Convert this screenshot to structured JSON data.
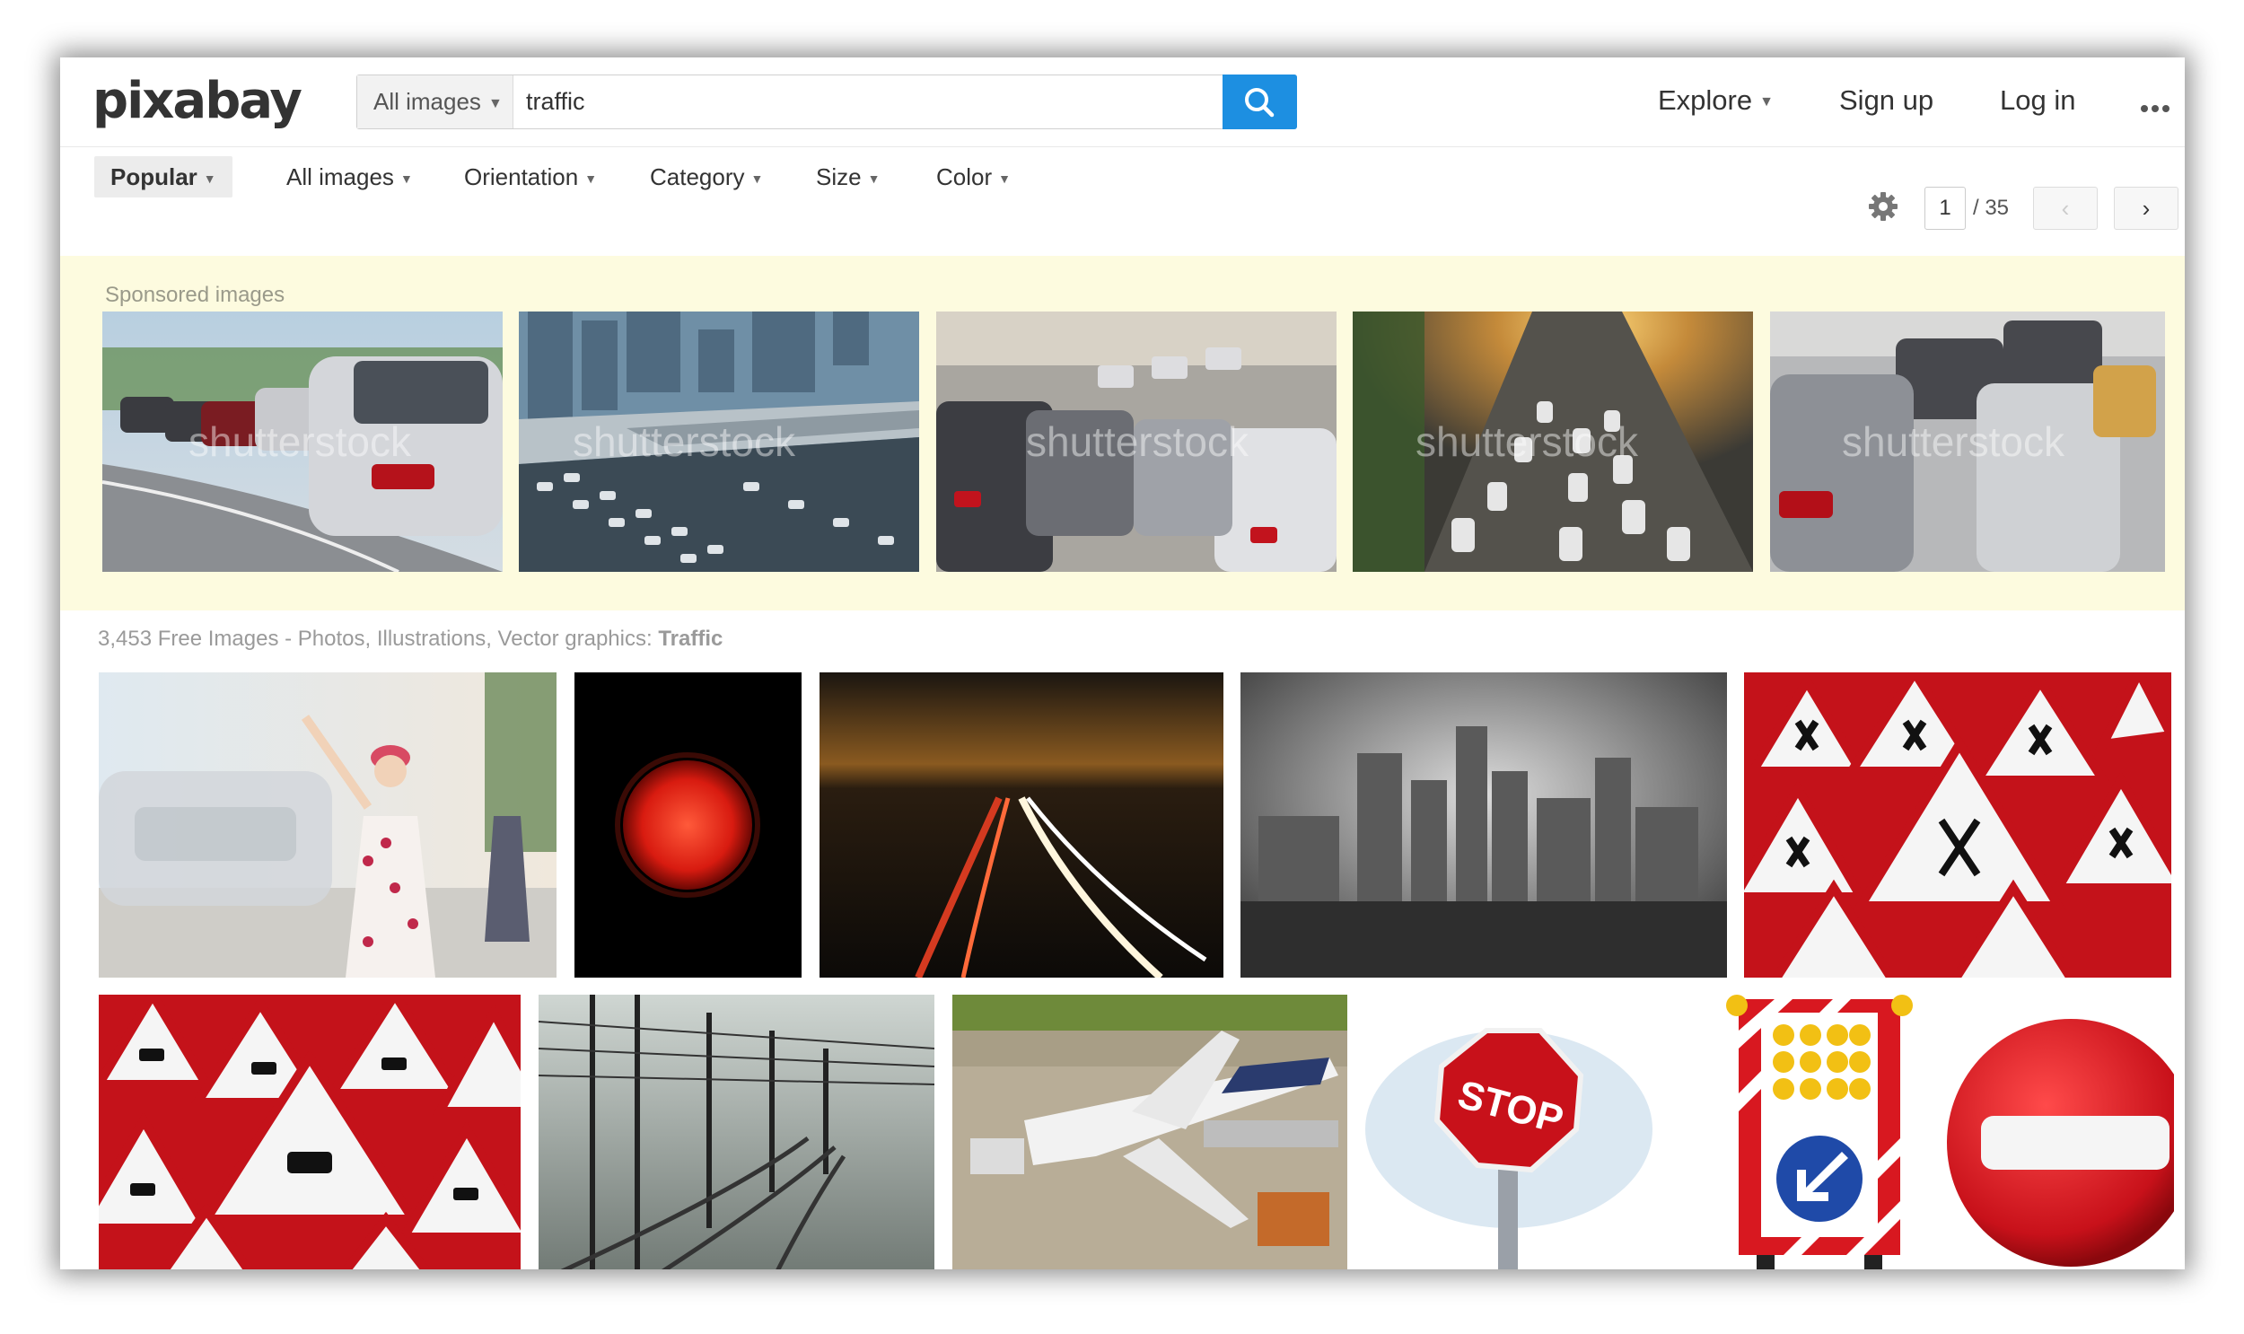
{
  "header": {
    "logo": "pixabay",
    "search": {
      "type_label": "All images",
      "query": "traffic",
      "button_icon": "search-icon"
    },
    "nav": {
      "explore": "Explore",
      "signup": "Sign up",
      "login": "Log in",
      "more_icon": "more-dots-icon"
    }
  },
  "filters": {
    "sort": "Popular",
    "image_type": "All images",
    "orientation": "Orientation",
    "category": "Category",
    "size": "Size",
    "color": "Color",
    "settings_icon": "gear-icon",
    "page_current": "1",
    "page_total": "/ 35",
    "prev_icon": "chevron-left-icon",
    "next_icon": "chevron-right-icon"
  },
  "sponsored": {
    "label": "Sponsored images",
    "watermark": "shutterstock",
    "images": [
      {
        "name": "cars-in-traffic-jam"
      },
      {
        "name": "highway-traffic-jam-city"
      },
      {
        "name": "rows-of-cars-traffic"
      },
      {
        "name": "aerial-highway-sunset"
      },
      {
        "name": "cars-close-up-traffic"
      }
    ]
  },
  "results": {
    "count_text": "3,453 Free Images - Photos, Illustrations, Vector graphics: ",
    "query_bold": "Traffic",
    "row1": [
      {
        "name": "woman-hailing-taxi"
      },
      {
        "name": "red-traffic-light"
      },
      {
        "name": "highway-night-light-trails"
      },
      {
        "name": "city-skyline-bw"
      },
      {
        "name": "warning-signs-pattern"
      }
    ],
    "row2": [
      {
        "name": "slippery-road-signs-pattern"
      },
      {
        "name": "railway-tracks-fog"
      },
      {
        "name": "airplane-at-gate"
      },
      {
        "name": "stop-sign",
        "text": "STOP"
      },
      {
        "name": "roadwork-barrier-sign"
      },
      {
        "name": "no-entry-sign"
      }
    ]
  },
  "colors": {
    "accent": "#1d8fe1",
    "sponsored_bg": "#fdfbdf"
  }
}
